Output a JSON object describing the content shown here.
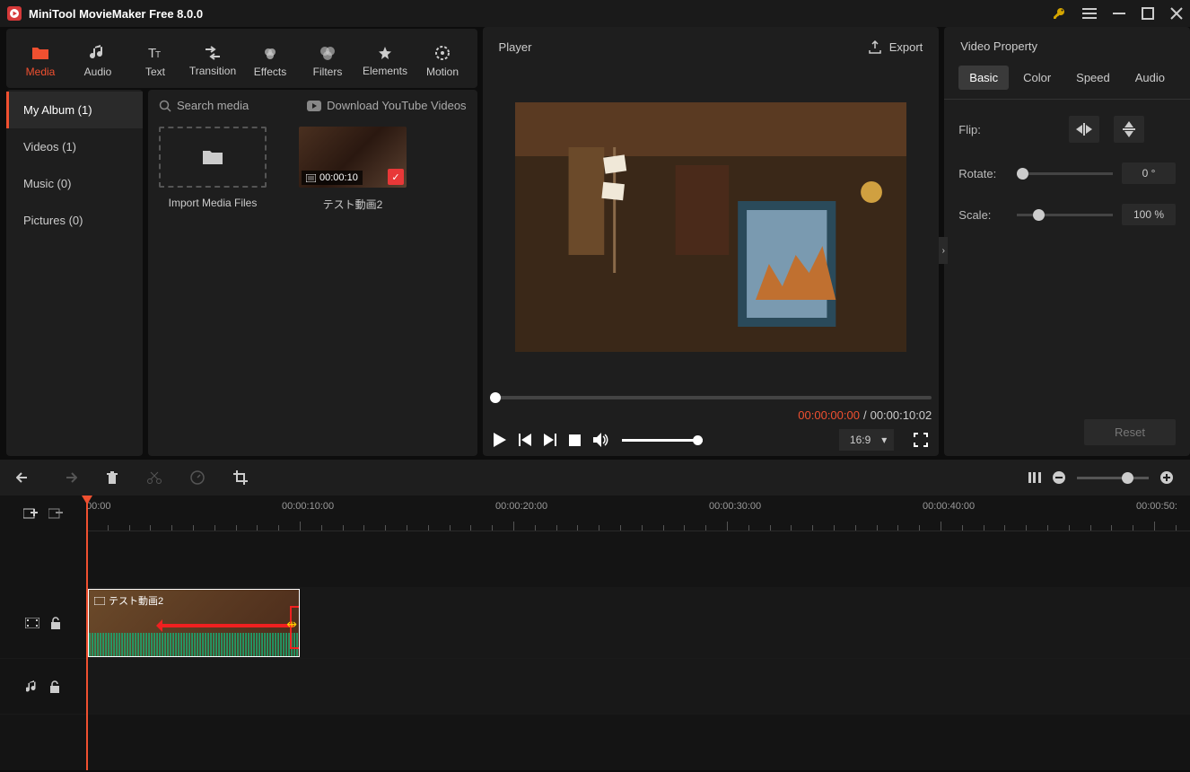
{
  "titlebar": {
    "title": "MiniTool MovieMaker Free 8.0.0"
  },
  "top_tabs": [
    {
      "label": "Media",
      "icon": "folder",
      "active": true
    },
    {
      "label": "Audio",
      "icon": "music"
    },
    {
      "label": "Text",
      "icon": "text"
    },
    {
      "label": "Transition",
      "icon": "transition"
    },
    {
      "label": "Effects",
      "icon": "effects"
    },
    {
      "label": "Filters",
      "icon": "filters"
    },
    {
      "label": "Elements",
      "icon": "elements"
    },
    {
      "label": "Motion",
      "icon": "motion"
    }
  ],
  "library": {
    "categories": [
      {
        "label": "My Album (1)",
        "active": true
      },
      {
        "label": "Videos (1)"
      },
      {
        "label": "Music (0)"
      },
      {
        "label": "Pictures (0)"
      }
    ],
    "search_placeholder": "Search media",
    "download_label": "Download YouTube Videos",
    "import_label": "Import Media Files",
    "media": [
      {
        "label": "テスト動画2",
        "duration": "00:00:10"
      }
    ]
  },
  "player": {
    "title": "Player",
    "export_label": "Export",
    "current_time": "00:00:00:00",
    "total_time": "00:00:10:02",
    "aspect": "16:9"
  },
  "property": {
    "title": "Video Property",
    "tabs": [
      "Basic",
      "Color",
      "Speed",
      "Audio"
    ],
    "active_tab": "Basic",
    "flip_label": "Flip:",
    "rotate_label": "Rotate:",
    "rotate_value": "0 °",
    "scale_label": "Scale:",
    "scale_value": "100 %",
    "reset_label": "Reset"
  },
  "timeline": {
    "ruler": [
      "00:00",
      "00:00:10:00",
      "00:00:20:00",
      "00:00:30:00",
      "00:00:40:00",
      "00:00:50:"
    ],
    "clip_label": "テスト動画2"
  }
}
